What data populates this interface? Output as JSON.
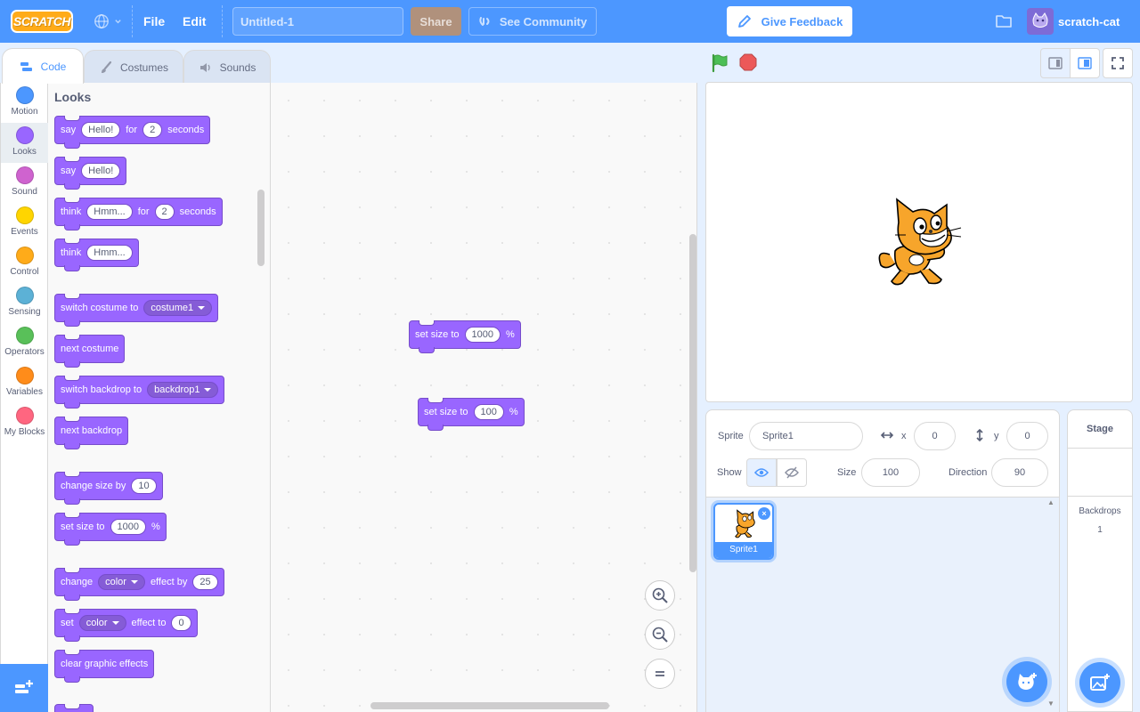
{
  "menubar": {
    "logo": "SCRATCH",
    "file_label": "File",
    "edit_label": "Edit",
    "project_title": "Untitled-1",
    "share_label": "Share",
    "community_label": "See Community",
    "feedback_label": "Give Feedback",
    "username": "scratch-cat"
  },
  "tabs": {
    "code": "Code",
    "costumes": "Costumes",
    "sounds": "Sounds"
  },
  "categories": [
    {
      "label": "Motion",
      "color": "#4c97ff"
    },
    {
      "label": "Looks",
      "color": "#9966ff"
    },
    {
      "label": "Sound",
      "color": "#cf63cf"
    },
    {
      "label": "Events",
      "color": "#ffd500"
    },
    {
      "label": "Control",
      "color": "#ffab19"
    },
    {
      "label": "Sensing",
      "color": "#5cb1d6"
    },
    {
      "label": "Operators",
      "color": "#59c059"
    },
    {
      "label": "Variables",
      "color": "#ff8c1a"
    },
    {
      "label": "My Blocks",
      "color": "#ff6680"
    }
  ],
  "palette": {
    "title": "Looks",
    "say_for": {
      "t1": "say",
      "v1": "Hello!",
      "t2": "for",
      "v2": "2",
      "t3": "seconds"
    },
    "say": {
      "t1": "say",
      "v1": "Hello!"
    },
    "think_for": {
      "t1": "think",
      "v1": "Hmm...",
      "t2": "for",
      "v2": "2",
      "t3": "seconds"
    },
    "think": {
      "t1": "think",
      "v1": "Hmm..."
    },
    "switch_costume": {
      "t1": "switch costume to",
      "v1": "costume1"
    },
    "next_costume": {
      "t1": "next costume"
    },
    "switch_backdrop": {
      "t1": "switch backdrop to",
      "v1": "backdrop1"
    },
    "next_backdrop": {
      "t1": "next backdrop"
    },
    "change_size": {
      "t1": "change size by",
      "v1": "10"
    },
    "set_size": {
      "t1": "set size to",
      "v1": "1000",
      "t2": "%"
    },
    "change_effect": {
      "t1": "change",
      "v1": "color",
      "t2": "effect by",
      "v2": "25"
    },
    "set_effect": {
      "t1": "set",
      "v1": "color",
      "t2": "effect to",
      "v2": "0"
    },
    "clear_effects": {
      "t1": "clear graphic effects"
    }
  },
  "workspace": {
    "block1": {
      "t1": "set size to",
      "v1": "1000",
      "t2": "%"
    },
    "block2": {
      "t1": "set size to",
      "v1": "100",
      "t2": "%"
    }
  },
  "sprite_info": {
    "sprite_label": "Sprite",
    "sprite_name": "Sprite1",
    "x_label": "x",
    "x_value": "0",
    "y_label": "y",
    "y_value": "0",
    "show_label": "Show",
    "size_label": "Size",
    "size_value": "100",
    "direction_label": "Direction",
    "direction_value": "90"
  },
  "sprites": [
    {
      "name": "Sprite1"
    }
  ],
  "stage_pane": {
    "title": "Stage",
    "backdrops_label": "Backdrops",
    "backdrops_count": "1"
  }
}
